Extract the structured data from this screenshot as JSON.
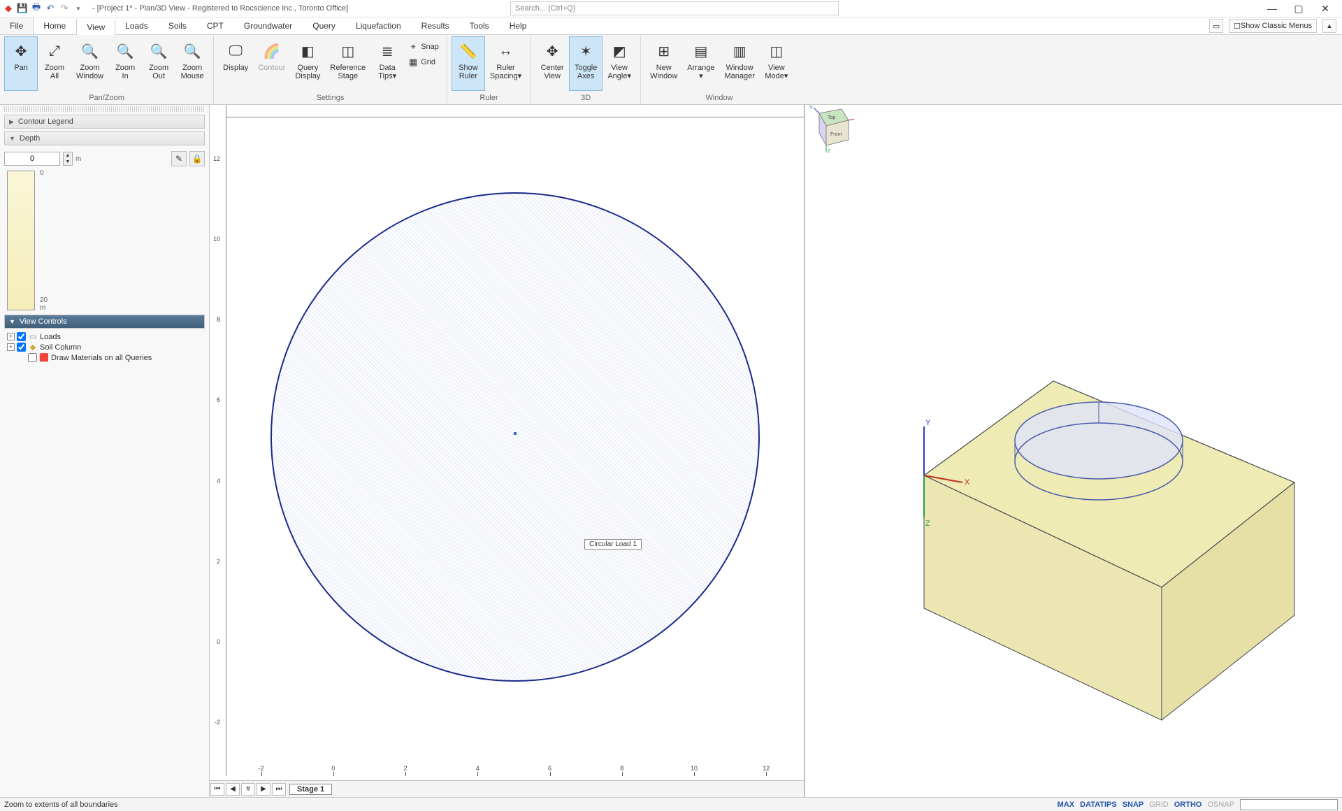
{
  "title": "- [Project 1* - Plan/3D View - Registered to Rocscience Inc., Toronto Office]",
  "search_placeholder": "Search... (Ctrl+Q)",
  "classic_menus": "Show Classic Menus",
  "tabs": {
    "file": "File",
    "home": "Home",
    "view": "View",
    "loads": "Loads",
    "soils": "Soils",
    "cpt": "CPT",
    "gw": "Groundwater",
    "query": "Query",
    "liq": "Liquefaction",
    "results": "Results",
    "tools": "Tools",
    "help": "Help"
  },
  "ribbon": {
    "panzoom": {
      "label": "Pan/Zoom",
      "pan": "Pan",
      "zoom_all": "Zoom\nAll",
      "zoom_window": "Zoom\nWindow",
      "zoom_in": "Zoom\nIn",
      "zoom_out": "Zoom\nOut",
      "zoom_mouse": "Zoom\nMouse"
    },
    "settings": {
      "label": "Settings",
      "display": "Display",
      "contour": "Contour",
      "query_display": "Query\nDisplay",
      "ref_stage": "Reference\nStage",
      "data_tips": "Data\nTips▾",
      "snap": "Snap",
      "grid": "Grid"
    },
    "ruler": {
      "label": "Ruler",
      "show": "Show\nRuler",
      "spacing": "Ruler\nSpacing▾"
    },
    "three": {
      "label": "3D",
      "center": "Center\nView",
      "axes": "Toggle\nAxes",
      "angle": "View\nAngle▾"
    },
    "window": {
      "label": "Window",
      "new": "New\nWindow",
      "arrange": "Arrange\n▾",
      "mgr": "Window\nManager",
      "mode": "View\nMode▾"
    }
  },
  "sidebar": {
    "contour_legend": "Contour Legend",
    "depth": "Depth",
    "depth_value": "0",
    "depth_unit": "m",
    "depth_top": "0",
    "depth_bottom": "20 m",
    "view_controls": "View Controls",
    "tree": {
      "loads": "Loads",
      "soil": "Soil Column",
      "draw": "Draw Materials on all Queries"
    }
  },
  "plan": {
    "load_label": "Circular Load 1",
    "stage": "Stage 1",
    "ticks": [
      "-2",
      "0",
      "2",
      "4",
      "6",
      "8",
      "10",
      "12"
    ]
  },
  "status": {
    "hint": "Zoom to extents of all boundaries",
    "max": "MAX",
    "datatips": "DATATIPS",
    "snap": "SNAP",
    "grid": "GRID",
    "ortho": "ORTHO",
    "osnap": "OSNAP"
  },
  "cube": {
    "top": "Top",
    "front": "Front"
  }
}
